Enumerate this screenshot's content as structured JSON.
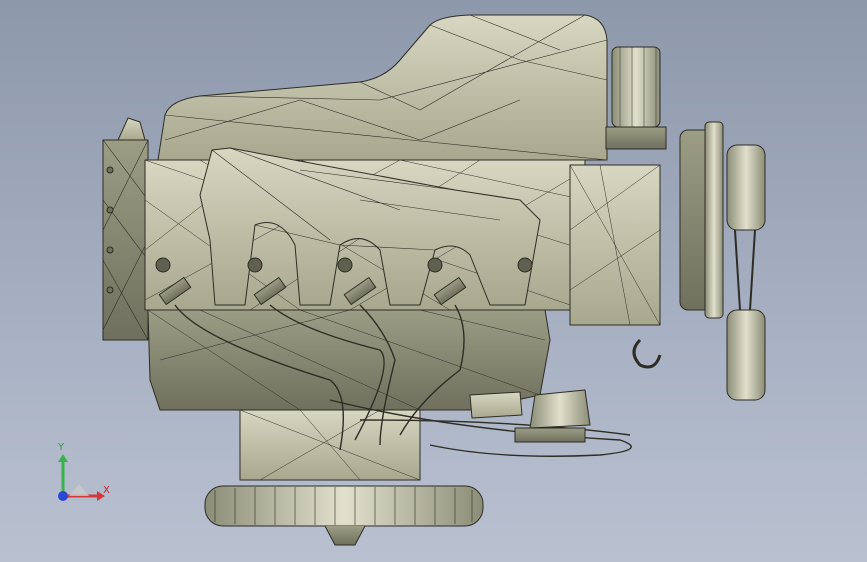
{
  "viewport": {
    "background_top": "#8e98ab",
    "background_bottom": "#b9c1d1",
    "model_name": "engine-assembly-wireframe",
    "model_fill": "#c9c9b0",
    "model_shadow": "#8a8b74",
    "edge_color": "#2d2d24"
  },
  "triad": {
    "x_label": "X",
    "y_label": "Y",
    "x_color": "#d23a3a",
    "y_color": "#36b34a",
    "z_color": "#2a47d6"
  }
}
